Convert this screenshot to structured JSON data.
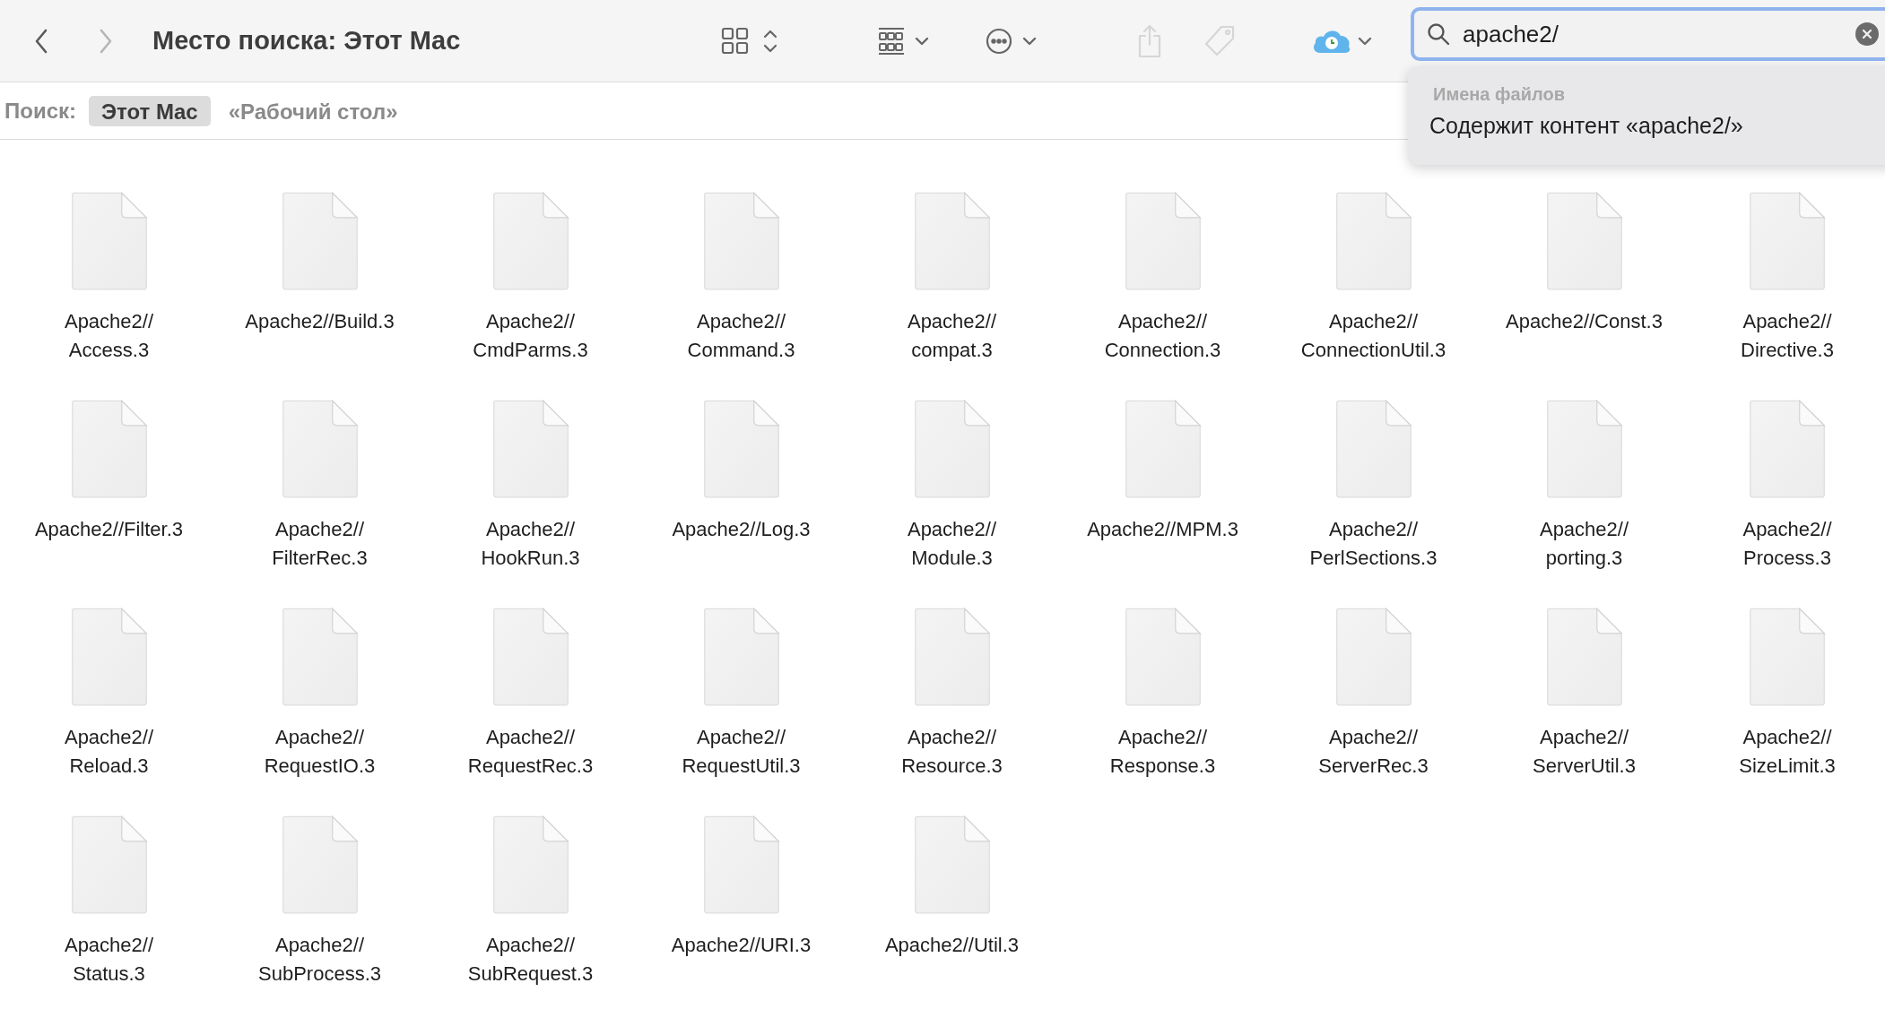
{
  "toolbar": {
    "nav": [
      {
        "kind": "back",
        "disabled": false
      },
      {
        "kind": "forward",
        "disabled": true
      }
    ],
    "title": "Место поиска: Этот Mac",
    "tools": [
      {
        "kind": "view",
        "disabled": false
      },
      {
        "kind": "group",
        "disabled": false
      },
      {
        "kind": "more",
        "disabled": false
      },
      {
        "kind": "share",
        "disabled": true
      },
      {
        "kind": "tag",
        "disabled": true
      },
      {
        "kind": "cloud",
        "disabled": false
      }
    ]
  },
  "search": {
    "value": "apache2/",
    "suggestions": {
      "section": "Имена файлов",
      "items": [
        "Содержит контент «apache2/»"
      ]
    }
  },
  "scope_bar": {
    "label": "Поиск:",
    "scopes": [
      {
        "label": "Этот Mac",
        "selected": true
      },
      {
        "label": "«Рабочий стол»",
        "selected": false
      }
    ]
  },
  "files": [
    {
      "lines": [
        "Apache2//",
        "Access.3"
      ]
    },
    {
      "lines": [
        "Apache2//Build.3"
      ]
    },
    {
      "lines": [
        "Apache2//",
        "CmdParms.3"
      ]
    },
    {
      "lines": [
        "Apache2//",
        "Command.3"
      ]
    },
    {
      "lines": [
        "Apache2//",
        "compat.3"
      ]
    },
    {
      "lines": [
        "Apache2//",
        "Connection.3"
      ]
    },
    {
      "lines": [
        "Apache2//",
        "ConnectionUtil.3"
      ]
    },
    {
      "lines": [
        "Apache2//Const.3"
      ]
    },
    {
      "lines": [
        "Apache2//",
        "Directive.3"
      ]
    },
    {
      "lines": [
        "Apache2//Filter.3"
      ]
    },
    {
      "lines": [
        "Apache2//",
        "FilterRec.3"
      ]
    },
    {
      "lines": [
        "Apache2//",
        "HookRun.3"
      ]
    },
    {
      "lines": [
        "Apache2//Log.3"
      ]
    },
    {
      "lines": [
        "Apache2//",
        "Module.3"
      ]
    },
    {
      "lines": [
        "Apache2//MPM.3"
      ]
    },
    {
      "lines": [
        "Apache2//",
        "PerlSections.3"
      ]
    },
    {
      "lines": [
        "Apache2//",
        "porting.3"
      ]
    },
    {
      "lines": [
        "Apache2//",
        "Process.3"
      ]
    },
    {
      "lines": [
        "Apache2//",
        "Reload.3"
      ]
    },
    {
      "lines": [
        "Apache2//",
        "RequestIO.3"
      ]
    },
    {
      "lines": [
        "Apache2//",
        "RequestRec.3"
      ]
    },
    {
      "lines": [
        "Apache2//",
        "RequestUtil.3"
      ]
    },
    {
      "lines": [
        "Apache2//",
        "Resource.3"
      ]
    },
    {
      "lines": [
        "Apache2//",
        "Response.3"
      ]
    },
    {
      "lines": [
        "Apache2//",
        "ServerRec.3"
      ]
    },
    {
      "lines": [
        "Apache2//",
        "ServerUtil.3"
      ]
    },
    {
      "lines": [
        "Apache2//",
        "SizeLimit.3"
      ]
    },
    {
      "lines": [
        "Apache2//",
        "Status.3"
      ]
    },
    {
      "lines": [
        "Apache2//",
        "SubProcess.3"
      ]
    },
    {
      "lines": [
        "Apache2//",
        "SubRequest.3"
      ]
    },
    {
      "lines": [
        "Apache2//URI.3"
      ]
    },
    {
      "lines": [
        "Apache2//Util.3"
      ]
    }
  ]
}
